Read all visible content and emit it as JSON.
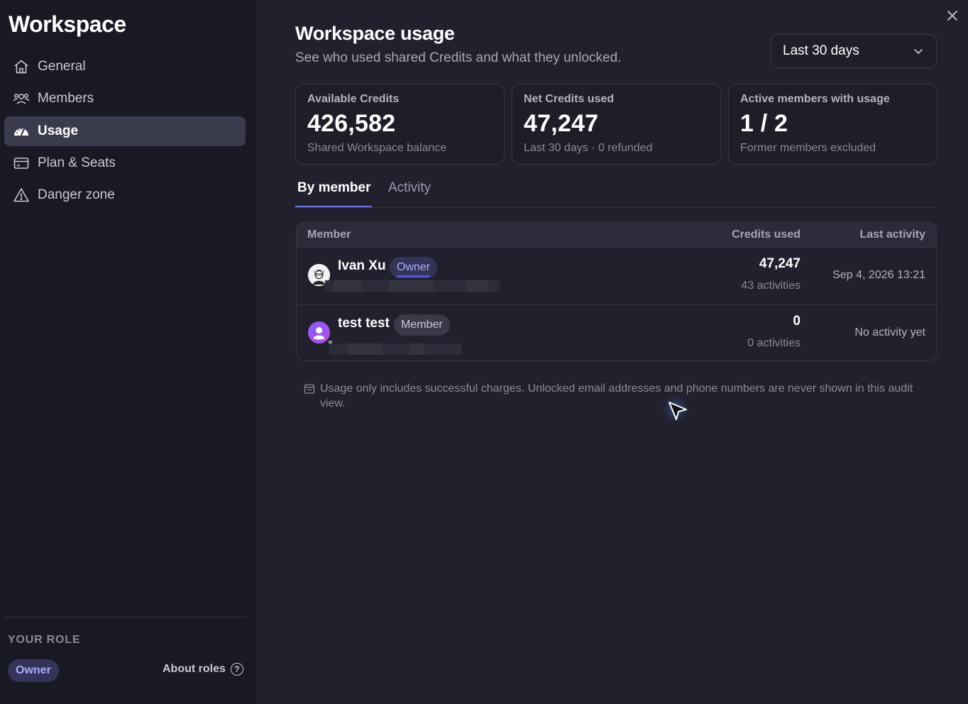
{
  "sidebar": {
    "title": "Workspace",
    "items": [
      {
        "label": "General",
        "icon": "home-icon"
      },
      {
        "label": "Members",
        "icon": "members-icon"
      },
      {
        "label": "Usage",
        "icon": "gauge-icon",
        "active": true
      },
      {
        "label": "Plan & Seats",
        "icon": "card-icon"
      },
      {
        "label": "Danger zone",
        "icon": "warning-icon"
      }
    ],
    "role_label": "YOUR ROLE",
    "role_value": "Owner",
    "about_roles": "About roles",
    "about_roles_icon": "?"
  },
  "header": {
    "title": "Workspace usage",
    "subtitle": "See who used shared Credits and what they unlocked.",
    "range": "Last 30 days"
  },
  "cards": [
    {
      "label": "Available Credits",
      "value": "426,582",
      "sub": "Shared Workspace balance"
    },
    {
      "label": "Net Credits used",
      "value": "47,247",
      "sub": "Last 30 days · 0 refunded"
    },
    {
      "label": "Active members with usage",
      "value": "1 / 2",
      "sub": "Former members excluded"
    }
  ],
  "tabs": [
    {
      "label": "By member",
      "active": true
    },
    {
      "label": "Activity",
      "active": false
    }
  ],
  "table": {
    "headers": {
      "member": "Member",
      "credits": "Credits used",
      "last": "Last activity"
    },
    "rows": [
      {
        "name": "Ivan Xu",
        "role": "Owner",
        "credits": "47,247",
        "activities": "43 activities",
        "last": "Sep 4, 2026 13:21"
      },
      {
        "name": "test test",
        "role": "Member",
        "credits": "0",
        "activities": "0 activities",
        "last": "No activity yet"
      }
    ]
  },
  "note": "Usage only includes successful charges. Unlocked email addresses and phone numbers are never shown in this audit view.",
  "colors": {
    "accent": "#6f74e8",
    "owner_badge": "#a8aefc",
    "background": "#21212e",
    "sidebar": "#191923"
  }
}
